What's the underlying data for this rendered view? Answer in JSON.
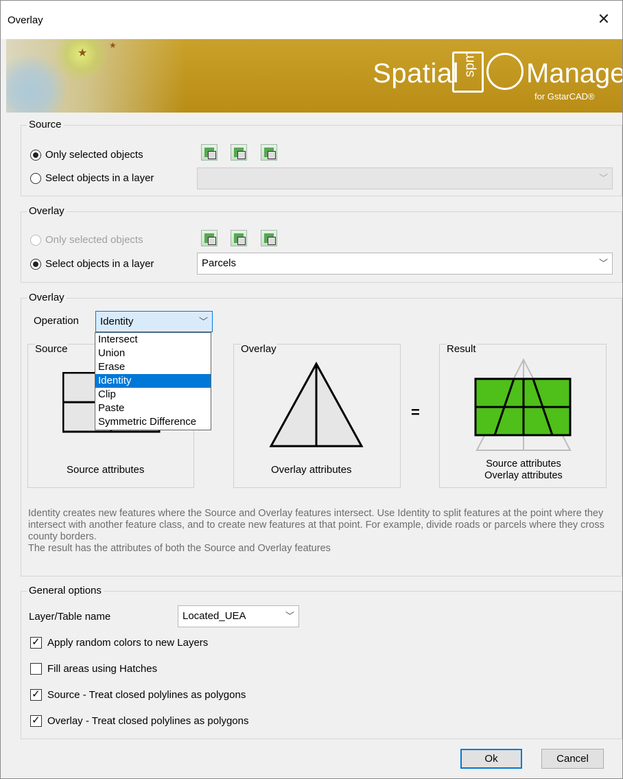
{
  "window": {
    "title": "Overlay",
    "close_glyph": "✕"
  },
  "banner": {
    "brand_left": "Spatial",
    "logo_text": "spm",
    "brand_right": "Manager",
    "brand_sub": "for GstarCAD®"
  },
  "source_group": {
    "legend": "Source",
    "radio_selected_label": "Only selected objects",
    "radio_layer_label": "Select objects in a layer",
    "layer_value": ""
  },
  "overlay_group": {
    "legend": "Overlay",
    "radio_selected_label": "Only selected objects",
    "radio_layer_label": "Select objects in a layer",
    "layer_value": "Parcels"
  },
  "operation_group": {
    "legend": "Overlay",
    "operation_label": "Operation",
    "operation_value": "Identity",
    "options": [
      "Intersect",
      "Union",
      "Erase",
      "Identity",
      "Clip",
      "Paste",
      "Symmetric Difference"
    ],
    "selected_index": 3,
    "panels": {
      "source_title": "Source",
      "source_caption": "Source attributes",
      "overlay_title": "Overlay",
      "overlay_caption": "Overlay attributes",
      "result_title": "Result",
      "result_caption_1": "Source attributes",
      "result_caption_2": "Overlay attributes",
      "plus": "+",
      "equals": "="
    },
    "description": "Identity creates new features where the Source and Overlay features intersect. Use Identity to split features at the point where they intersect with another feature class, and to create new features at that point. For example, divide roads or parcels where they cross county borders.",
    "description_2": "The result has the attributes of both the Source and Overlay features"
  },
  "general": {
    "legend": "General options",
    "table_label": "Layer/Table name",
    "table_value": "Located_UEA",
    "checks": [
      {
        "label": "Apply random colors to new Layers",
        "checked": true
      },
      {
        "label": "Fill areas using Hatches",
        "checked": false
      },
      {
        "label": "Source - Treat closed polylines as polygons",
        "checked": true
      },
      {
        "label": "Overlay - Treat closed polylines as polygons",
        "checked": true
      }
    ]
  },
  "buttons": {
    "ok": "Ok",
    "cancel": "Cancel"
  },
  "colors": {
    "banner": "#c39a1f",
    "result_fill": "#4fbf1a",
    "selection": "#0078d7"
  }
}
